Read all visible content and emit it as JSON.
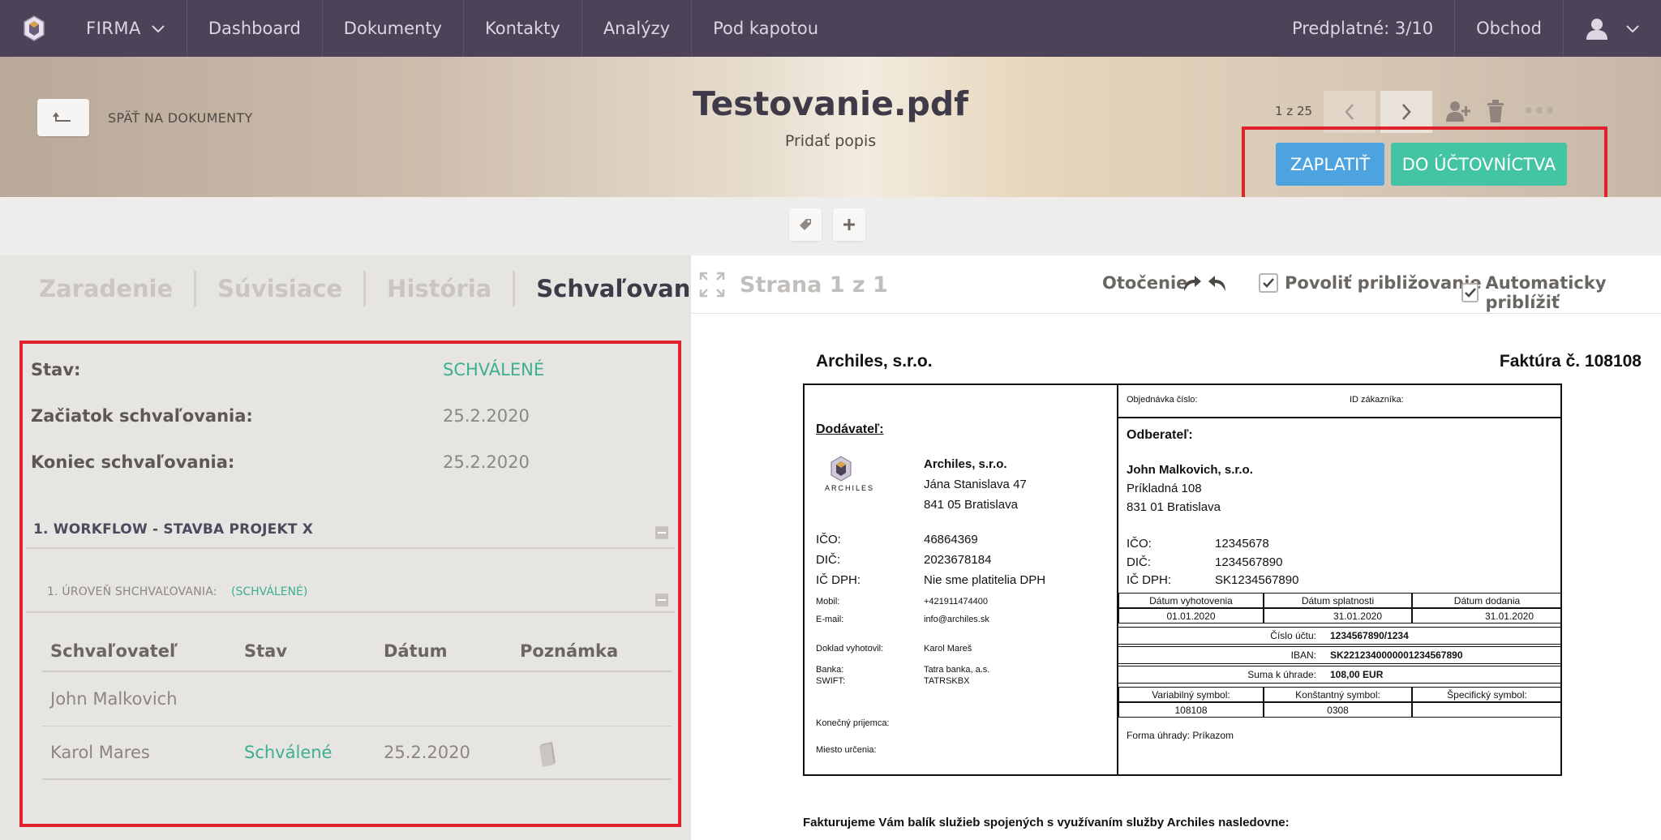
{
  "nav": {
    "company": "FIRMA",
    "items": [
      "Dashboard",
      "Dokumenty",
      "Kontakty",
      "Analýzy",
      "Pod kapotou"
    ],
    "subscription": "Predplatné: 3/10",
    "shop": "Obchod"
  },
  "header": {
    "back_label": "SPÄŤ NA DOKUMENTY",
    "title": "Testovanie.pdf",
    "description": "Pridať popis",
    "pager": "1 z 25",
    "pay_button": "ZAPLATIŤ",
    "accounting_button": "DO ÚČTOVNÍCTVA"
  },
  "tabs": [
    "Zaradenie",
    "Súvisiace",
    "História",
    "Schvaľovanie"
  ],
  "approval": {
    "status_label": "Stav:",
    "status_value": "SCHVÁLENÉ",
    "start_label": "Začiatok schvaľovania:",
    "start_value": "25.2.2020",
    "end_label": "Koniec schvaľovania:",
    "end_value": "25.2.2020",
    "workflow_title": "1. WORKFLOW - STAVBA PROJEKT X",
    "level_title": "1. ÚROVEŇ SHCHVAĽOVANIA:",
    "level_state": "(SCHVÁLENÉ)",
    "columns": [
      "Schvaľovateľ",
      "Stav",
      "Dátum",
      "Poznámka"
    ],
    "rows": [
      {
        "approver": "John Malkovich",
        "state": "",
        "date": ""
      },
      {
        "approver": "Karol Mares",
        "state": "Schválené",
        "date": "25.2.2020"
      }
    ]
  },
  "viewer": {
    "page": "Strana 1 z 1",
    "rotation": "Otočenie",
    "allow_zoom": "Povoliť približovanie",
    "auto_zoom": "Automaticky priblížiť"
  },
  "invoice": {
    "company": "Archiles, s.r.o.",
    "title": "Faktúra č. 108108",
    "order_no_label": "Objednávka číslo:",
    "customer_id_label": "ID zákazníka:",
    "supplier_label": "Dodávateľ:",
    "logo_text": "ARCHILES",
    "supplier_name": "Archiles, s.r.o.",
    "supplier_street": "Jána Stanislava 47",
    "supplier_city": "841 05 Bratislava",
    "ico_label": "IČO:",
    "dic_label": "DIČ:",
    "icdph_label": "IČ DPH:",
    "supplier_ico": "46864369",
    "supplier_dic": "2023678184",
    "supplier_icdph": "Nie sme platitelia DPH",
    "mobile_label": "Mobil:",
    "mobile": "+421911474400",
    "email_label": "E-mail:",
    "email": "info@archiles.sk",
    "issued_by_label": "Doklad vyhotovil:",
    "issued_by": "Karol Mareš",
    "bank_label": "Banka:",
    "swift_label": "SWIFT:",
    "bank": "Tatra banka, a.s.",
    "swift": "TATRSKBX",
    "final_recipient_label": "Konečný prijemca:",
    "destination_label": "Miesto určenia:",
    "customer_label": "Odberateľ:",
    "customer_name": "John Malkovich, s.r.o.",
    "customer_street": "Príkladná 108",
    "customer_city": "831 01 Bratislava",
    "customer_ico": "12345678",
    "customer_dic": "1234567890",
    "customer_icdph": "SK1234567890",
    "date_issue_label": "Dátum vyhotovenia",
    "date_due_label": "Dátum splatnosti",
    "date_delivery_label": "Dátum dodania",
    "date_issue": "01.01.2020",
    "date_due": "31.01.2020",
    "date_delivery": "31.01.2020",
    "account_label": "Číslo účtu:",
    "account": "1234567890/1234",
    "iban_label": "IBAN:",
    "iban": "SK2212340000001234567890",
    "amount_label": "Suma k úhrade:",
    "amount": "108,00 EUR",
    "vs_label": "Variabilný symbol:",
    "ks_label": "Konštantný symbol:",
    "ss_label": "Špecifický symbol:",
    "vs": "108108",
    "ks": "0308",
    "ss": "",
    "payment_method": "Forma úhrady: Príkazom",
    "intro": "Fakturujeme Vám balík služieb spojených s využívaním služby Archiles nasledovne:"
  }
}
